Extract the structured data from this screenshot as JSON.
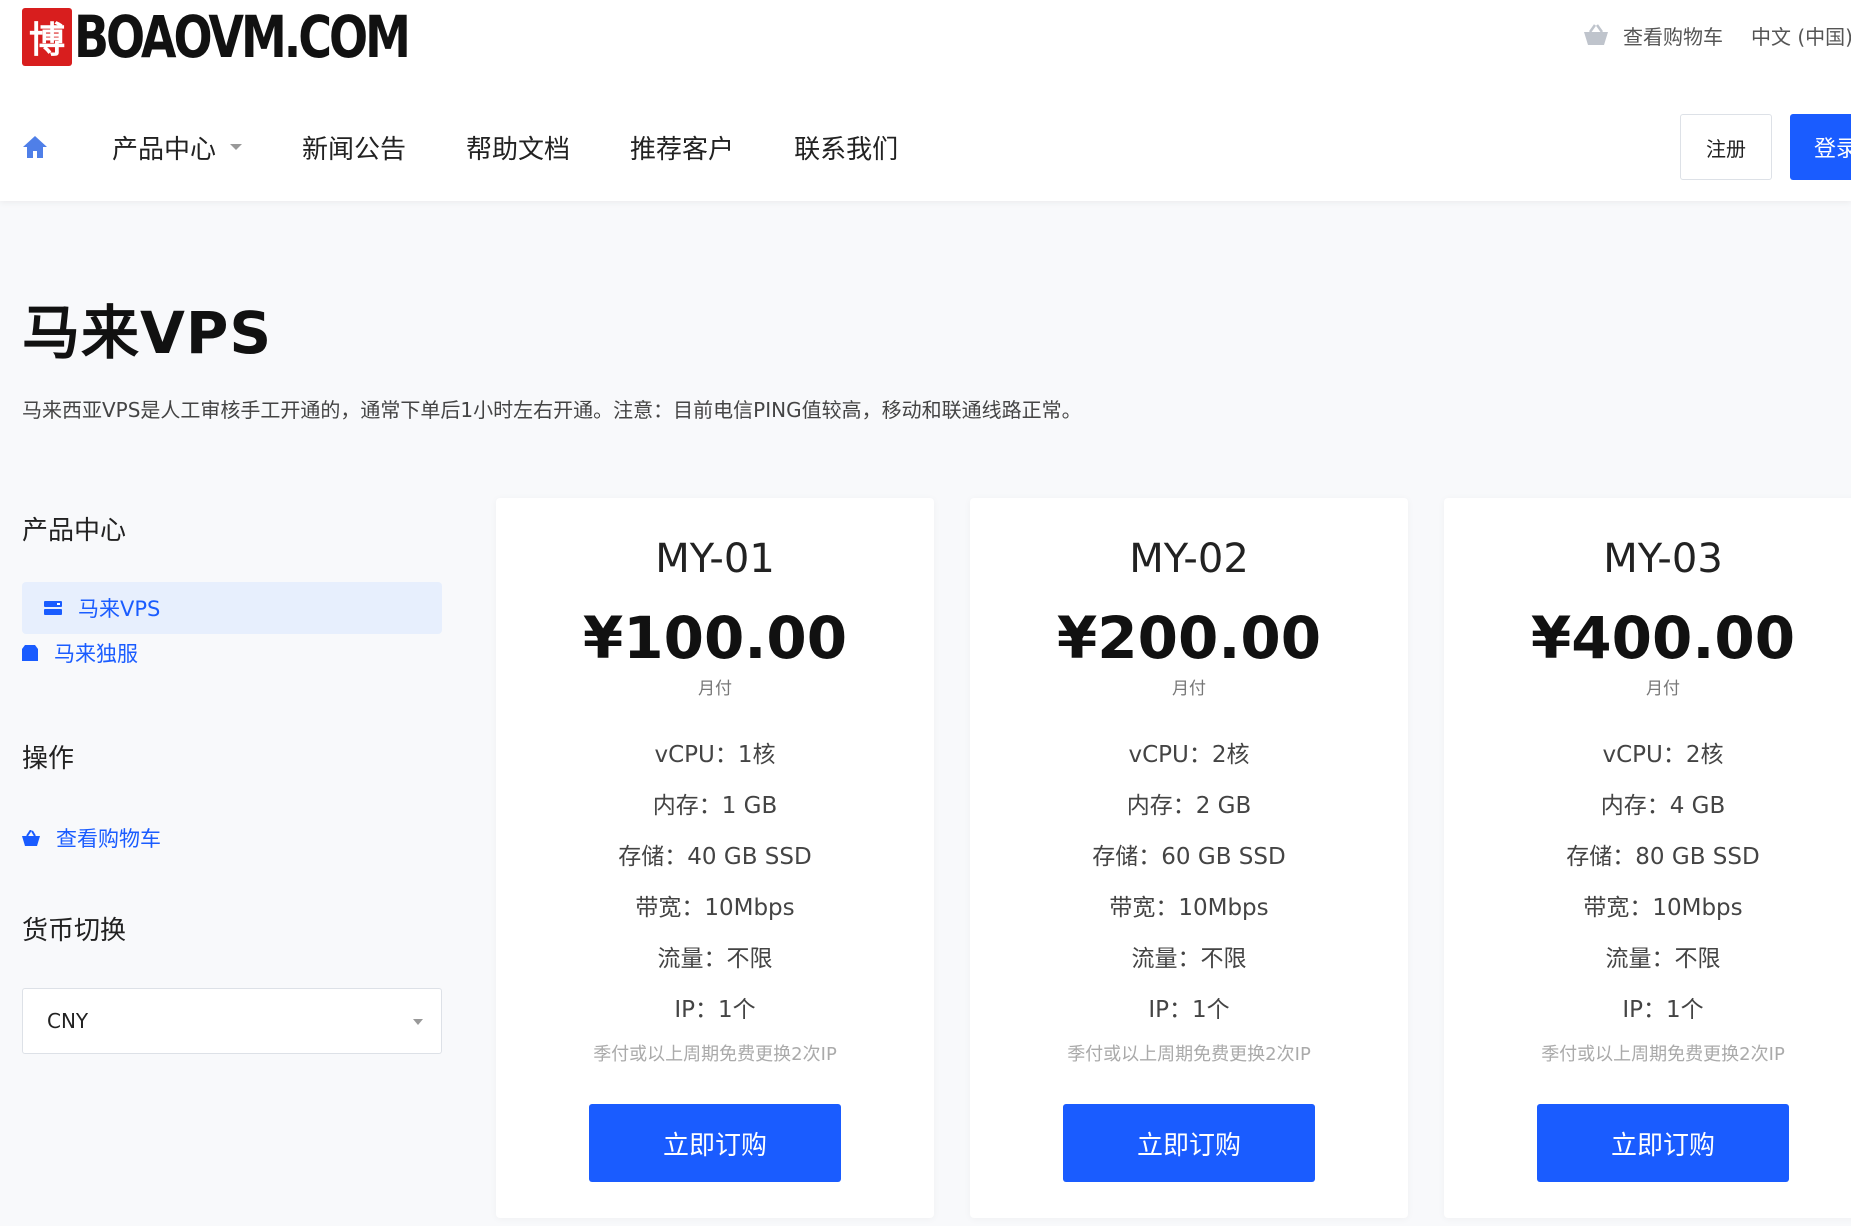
{
  "header": {
    "logo_seal": "博",
    "logo_text": "BOAOVM.COM",
    "cart_label": "查看购物车",
    "language": "中文 (中国)",
    "nav": [
      {
        "label": "产品中心",
        "has_dropdown": true
      },
      {
        "label": "新闻公告"
      },
      {
        "label": "帮助文档"
      },
      {
        "label": "推荐客户"
      },
      {
        "label": "联系我们"
      }
    ],
    "register_label": "注册",
    "login_label": "登录"
  },
  "page": {
    "title": "马来VPS",
    "description": "马来西亚VPS是人工审核手工开通的，通常下单后1小时左右开通。注意：目前电信PING值较高，移动和联通线路正常。"
  },
  "sidebar": {
    "products_heading": "产品中心",
    "product_links": [
      {
        "label": "马来VPS",
        "icon": "server-icon",
        "active": true
      },
      {
        "label": "马来独服",
        "icon": "box-icon",
        "active": false
      }
    ],
    "actions_heading": "操作",
    "actions": [
      {
        "label": "查看购物车",
        "icon": "cart-icon"
      }
    ],
    "currency_heading": "货币切换",
    "currency_value": "CNY"
  },
  "products": [
    {
      "name": "MY-01",
      "price": "¥100.00",
      "cycle": "月付",
      "specs": [
        "vCPU：1核",
        "内存：1 GB",
        "存储：40 GB SSD",
        "带宽：10Mbps",
        "流量：不限",
        "IP：1个"
      ],
      "note": "季付或以上周期免费更换2次IP",
      "button": "立即订购"
    },
    {
      "name": "MY-02",
      "price": "¥200.00",
      "cycle": "月付",
      "specs": [
        "vCPU：2核",
        "内存：2 GB",
        "存储：60 GB SSD",
        "带宽：10Mbps",
        "流量：不限",
        "IP：1个"
      ],
      "note": "季付或以上周期免费更换2次IP",
      "button": "立即订购"
    },
    {
      "name": "MY-03",
      "price": "¥400.00",
      "cycle": "月付",
      "specs": [
        "vCPU：2核",
        "内存：4 GB",
        "存储：80 GB SSD",
        "带宽：10Mbps",
        "流量：不限",
        "IP：1个"
      ],
      "note": "季付或以上周期免费更换2次IP",
      "button": "立即订购"
    }
  ],
  "colors": {
    "accent": "#1a5cff",
    "active_bg": "#e7effd",
    "logo_red": "#d81e1e"
  }
}
